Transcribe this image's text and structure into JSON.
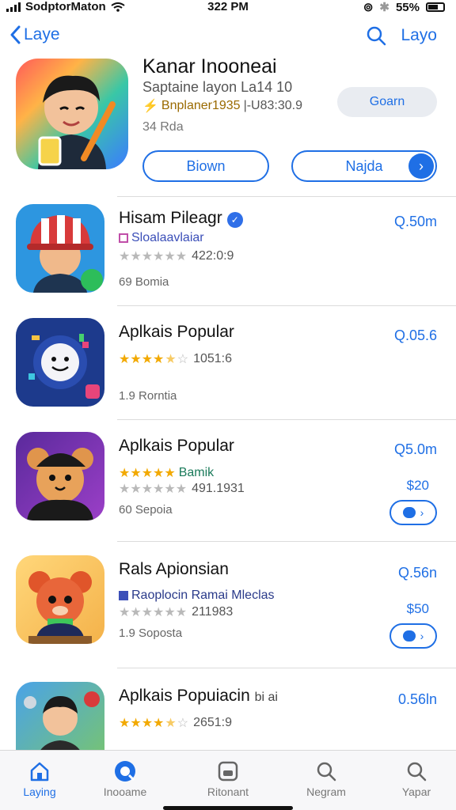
{
  "status": {
    "carrier": "SodptorMaton",
    "time": "322 PM",
    "battery": "55%"
  },
  "nav": {
    "back_label": "Laye",
    "right_label": "Layo"
  },
  "featured": {
    "title": "Kanar Inooneai",
    "subtitle": "Saptaine layon La14 10",
    "developer": "Bnplaner1935",
    "developer_suffix": "|-U83:30.9",
    "size": "34 Rda",
    "get_label": "Goarn",
    "button_left": "Biown",
    "button_right": "Najda"
  },
  "apps": [
    {
      "name": "Hisam Pileagr",
      "line2": "Sloalaavlaiar",
      "rating": 0,
      "rating_text": "422:0:9",
      "meta": "69 Bomia",
      "price": "Q.50m"
    },
    {
      "name": "Aplkais Popular",
      "rating": 4.5,
      "rating_text": "1051:6",
      "meta": "1.9 Rorntia",
      "price": "Q.05.6"
    },
    {
      "name": "Aplkais Popular",
      "line2": "Bamik",
      "rating": 5,
      "rating2": 0,
      "rating_text": "491.1931",
      "meta": "60 Sepoia",
      "price": "Q5.0m",
      "price2": "$20"
    },
    {
      "name": "Rals Apionsian",
      "line2": "Raoplocin Ramai Mleclas",
      "rating": 0,
      "rating_text": "211983",
      "meta": "1.9 Soposta",
      "price": "Q.56n",
      "price2": "$50"
    },
    {
      "name": "Aplkais Popuiacin",
      "name_suffix": "bi ai",
      "rating": 4.5,
      "rating_text": "2651:9",
      "price": "0.56ln"
    }
  ],
  "tabs": [
    {
      "label": "Laying",
      "icon": "home-icon",
      "active": true
    },
    {
      "label": "Inooame",
      "icon": "app-store-icon",
      "active": false
    },
    {
      "label": "Ritonant",
      "icon": "square-icon",
      "active": false
    },
    {
      "label": "Negram",
      "icon": "search-icon",
      "active": false
    },
    {
      "label": "Yapar",
      "icon": "search-icon",
      "active": false
    }
  ],
  "colors": {
    "accent": "#1f6fe5",
    "star": "#f2a900"
  }
}
